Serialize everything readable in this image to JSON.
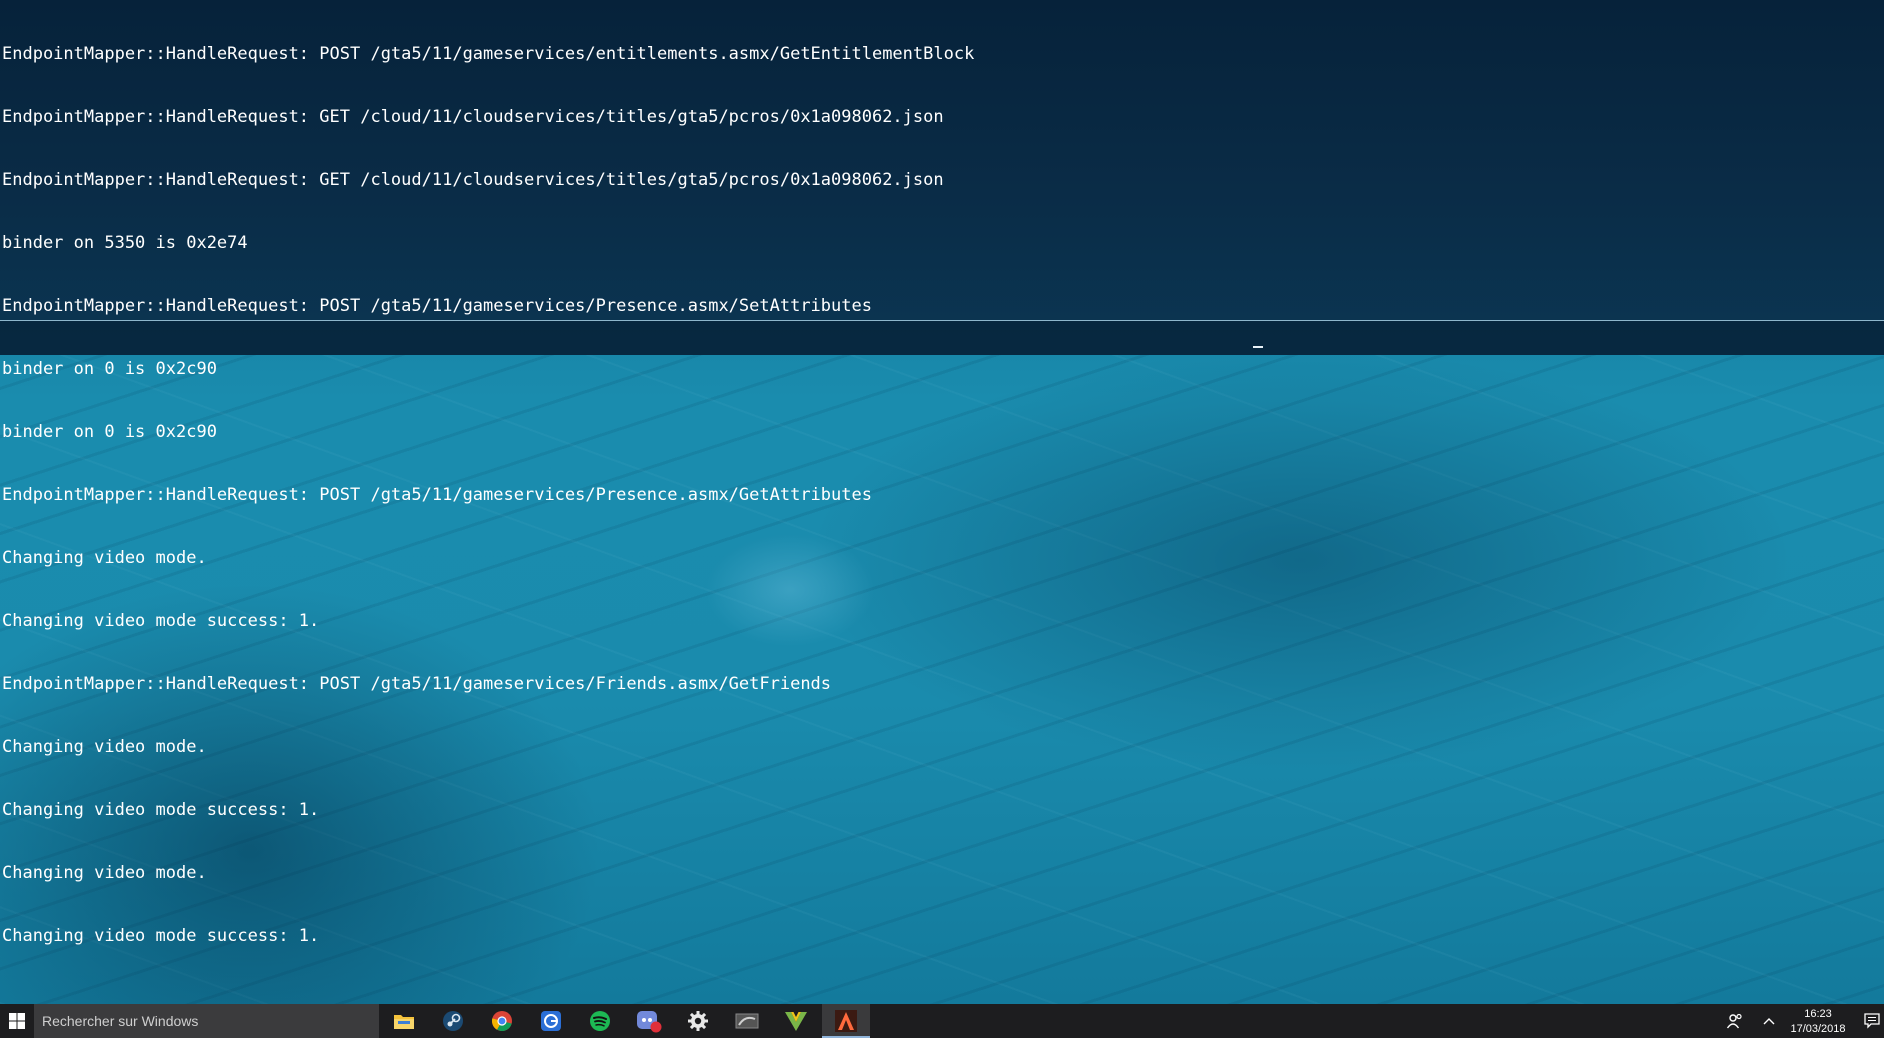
{
  "console": {
    "lines": [
      "EndpointMapper::HandleRequest: POST /gta5/11/gameservices/entitlements.asmx/GetEntitlementBlock",
      "EndpointMapper::HandleRequest: GET /cloud/11/cloudservices/titles/gta5/pcros/0x1a098062.json",
      "EndpointMapper::HandleRequest: GET /cloud/11/cloudservices/titles/gta5/pcros/0x1a098062.json",
      "binder on 5350 is 0x2e74",
      "EndpointMapper::HandleRequest: POST /gta5/11/gameservices/Presence.asmx/SetAttributes",
      "binder on 0 is 0x2c90",
      "binder on 0 is 0x2c90",
      "EndpointMapper::HandleRequest: POST /gta5/11/gameservices/Presence.asmx/GetAttributes",
      "Changing video mode.",
      "Changing video mode success: 1.",
      "EndpointMapper::HandleRequest: POST /gta5/11/gameservices/Friends.asmx/GetFriends",
      "Changing video mode.",
      "Changing video mode success: 1.",
      "Changing video mode.",
      "Changing video mode success: 1."
    ],
    "input_value": ""
  },
  "taskbar": {
    "search_placeholder": "Rechercher sur Windows",
    "apps": [
      {
        "name": "file-explorer",
        "icon": "folder-icon"
      },
      {
        "name": "steam",
        "icon": "steam-icon"
      },
      {
        "name": "chrome",
        "icon": "chrome-icon"
      },
      {
        "name": "mail",
        "icon": "mail-icon"
      },
      {
        "name": "spotify",
        "icon": "spotify-icon"
      },
      {
        "name": "discord",
        "icon": "discord-icon",
        "badge": "30"
      },
      {
        "name": "settings",
        "icon": "gear-icon"
      },
      {
        "name": "nvidia",
        "icon": "nvidia-icon"
      },
      {
        "name": "gta5",
        "icon": "gta-v-icon"
      },
      {
        "name": "launcher",
        "icon": "launcher-a-icon",
        "active": true
      }
    ],
    "clock": {
      "time": "16:23",
      "date": "17/03/2018"
    }
  },
  "colors": {
    "console_bg": "#08283f",
    "desktop_bg": "#1a8cae",
    "taskbar_bg": "#1d1d1f",
    "console_text": "#ffffff"
  }
}
